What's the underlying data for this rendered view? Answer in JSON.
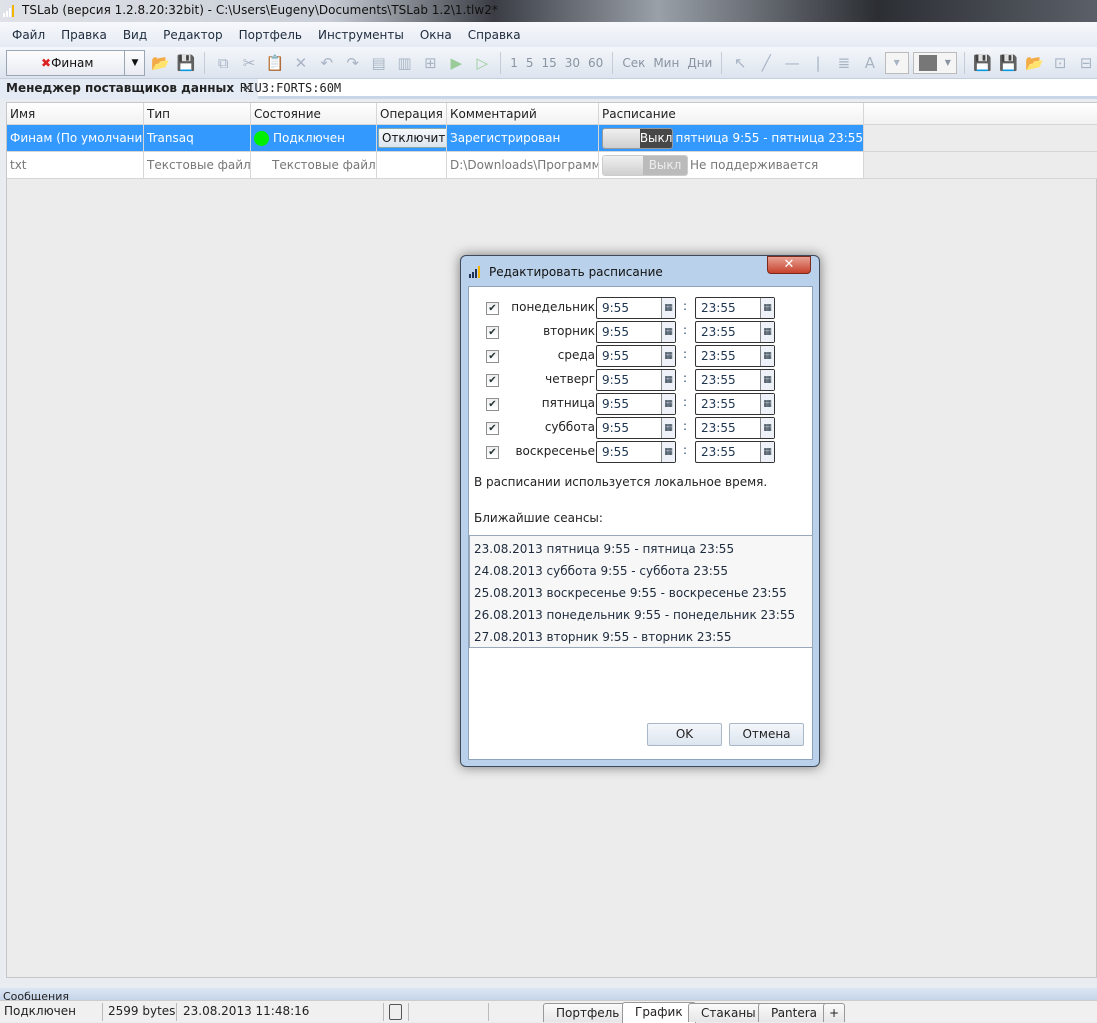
{
  "window": {
    "title": "TSLab (версия 1.2.8.20:32bit) - C:\\Users\\Eugeny\\Documents\\TSLab 1.2\\1.tlw2*"
  },
  "menu": [
    "Файл",
    "Правка",
    "Вид",
    "Редактор",
    "Портфель",
    "Инструменты",
    "Окна",
    "Справка"
  ],
  "toolbar": {
    "provider": "Финам",
    "intervals": [
      "1",
      "5",
      "15",
      "30",
      "60"
    ],
    "units": [
      "Сек",
      "Мин",
      "Дни"
    ]
  },
  "tabs": {
    "active": "Менеджер поставщиков данных",
    "other": "RIU3:FORTS:60M"
  },
  "grid": {
    "headers": [
      "Имя",
      "Тип",
      "Состояние",
      "Операция",
      "Комментарий",
      "Расписание"
    ],
    "rows": [
      {
        "name": "Финам (По умолчанию)",
        "type": "Transaq",
        "state": "Подключен",
        "operation": "Отключить",
        "comment": "Зарегистрирован",
        "toggle": "Выкл",
        "schedule": "пятница 9:55 - пятница 23:55"
      },
      {
        "name": "txt",
        "type": "Текстовые файлы",
        "state": "Текстовые файлы",
        "operation": "",
        "comment": "D:\\Downloads\\Программы",
        "toggle": "Выкл",
        "schedule": "Не поддерживается"
      }
    ]
  },
  "dialog": {
    "title": "Редактировать расписание",
    "close": "✕",
    "days": [
      {
        "day": "понедельник",
        "from": "9:55",
        "to": "23:55",
        "checked": true
      },
      {
        "day": "вторник",
        "from": "9:55",
        "to": "23:55",
        "checked": true
      },
      {
        "day": "среда",
        "from": "9:55",
        "to": "23:55",
        "checked": true
      },
      {
        "day": "четверг",
        "from": "9:55",
        "to": "23:55",
        "checked": true
      },
      {
        "day": "пятница",
        "from": "9:55",
        "to": "23:55",
        "checked": true
      },
      {
        "day": "суббота",
        "from": "9:55",
        "to": "23:55",
        "checked": true
      },
      {
        "day": "воскресенье",
        "from": "9:55",
        "to": "23:55",
        "checked": true
      }
    ],
    "separator": ":",
    "note": "В расписании используется локальное время.",
    "nearest_label": "Ближайшие сеансы:",
    "sessions": [
      "23.08.2013 пятница 9:55 - пятница 23:55",
      "24.08.2013 суббота 9:55 - суббота 23:55",
      "25.08.2013 воскресенье 9:55 - воскресенье 23:55",
      "26.08.2013 понедельник 9:55 - понедельник 23:55",
      "27.08.2013 вторник 9:55 - вторник 23:55"
    ],
    "ok": "OK",
    "cancel": "Отмена"
  },
  "messages_label": "Сообщения",
  "status": {
    "connection": "Подключен",
    "bytes": "2599 bytes",
    "datetime": "23.08.2013 11:48:16"
  },
  "bottom_tabs": [
    "Портфель",
    "График",
    "Стаканы",
    "Pantera",
    "+"
  ],
  "colors": {
    "selection": "#3399ff",
    "connected": "#00ee00"
  }
}
